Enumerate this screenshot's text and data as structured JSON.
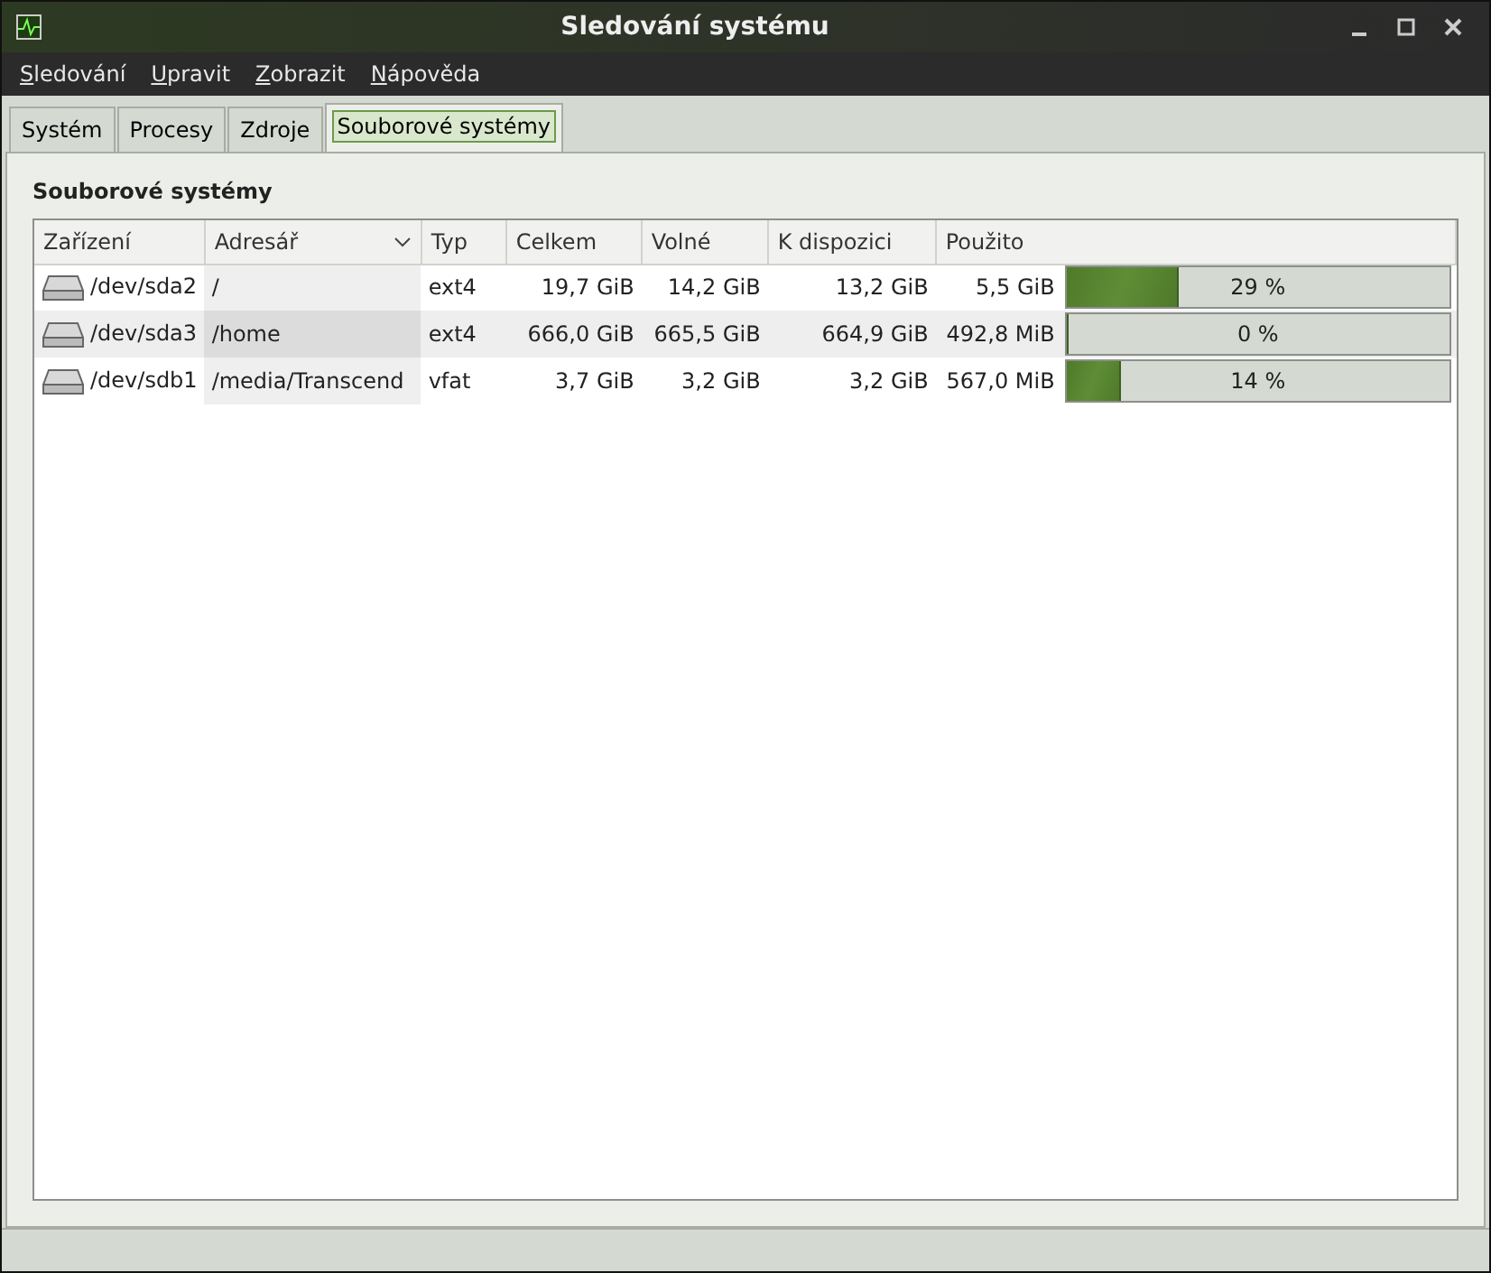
{
  "window": {
    "title": "Sledování systému"
  },
  "menu": [
    "Sledování",
    "Upravit",
    "Zobrazit",
    "Nápověda"
  ],
  "tabs": [
    {
      "label": "Systém",
      "selected": false
    },
    {
      "label": "Procesy",
      "selected": false
    },
    {
      "label": "Zdroje",
      "selected": false
    },
    {
      "label": "Souborové systémy",
      "selected": true
    }
  ],
  "section_title": "Souborové systémy",
  "table": {
    "columns": [
      {
        "label": "Zařízení",
        "sorted": false
      },
      {
        "label": "Adresář",
        "sorted": true
      },
      {
        "label": "Typ",
        "sorted": false
      },
      {
        "label": "Celkem",
        "sorted": false
      },
      {
        "label": "Volné",
        "sorted": false
      },
      {
        "label": "K dispozici",
        "sorted": false
      },
      {
        "label": "Použito",
        "sorted": false
      }
    ],
    "rows": [
      {
        "device": "/dev/sda2",
        "directory": "/",
        "type": "ext4",
        "total": "19,7 GiB",
        "free": "14,2 GiB",
        "available": "13,2 GiB",
        "used": "5,5 GiB",
        "level": 0.29,
        "percent": "29 %"
      },
      {
        "device": "/dev/sda3",
        "directory": "/home",
        "type": "ext4",
        "total": "666,0 GiB",
        "free": "665,5 GiB",
        "available": "664,9 GiB",
        "used": "492,8 MiB",
        "level": 0.0,
        "percent": "0 %"
      },
      {
        "device": "/dev/sdb1",
        "directory": "/media/Transcend",
        "type": "vfat",
        "total": "3,7 GiB",
        "free": "3,2 GiB",
        "available": "3,2 GiB",
        "used": "567,0 MiB",
        "level": 0.14,
        "percent": "14 %"
      }
    ]
  }
}
